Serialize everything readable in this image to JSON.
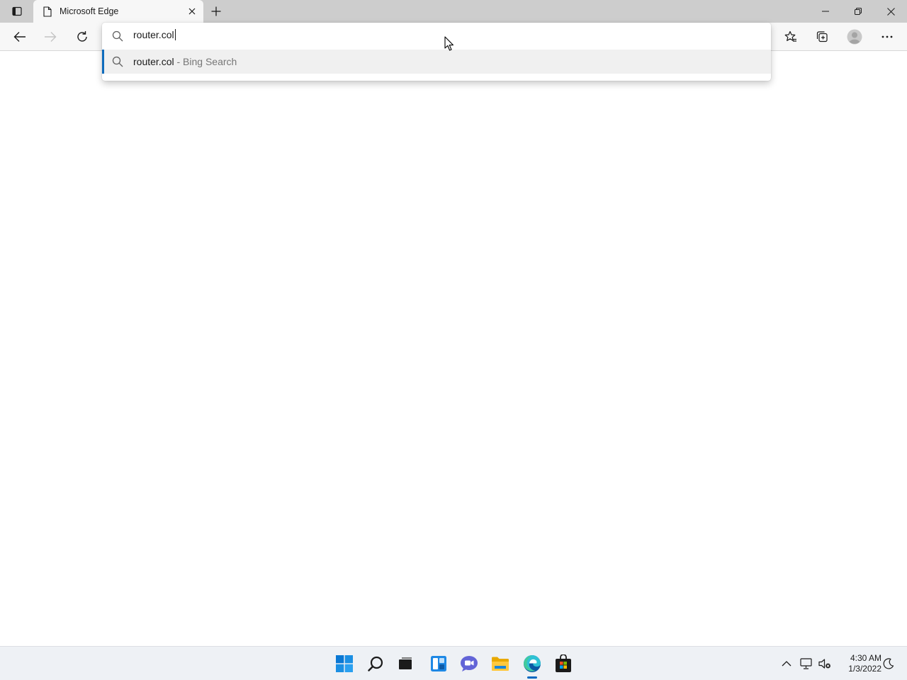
{
  "browser": {
    "tab": {
      "title": "Microsoft Edge"
    },
    "omnibox": {
      "query": "router.col",
      "suggestion": {
        "primary": "router.col",
        "secondary": " - Bing Search"
      }
    },
    "window_controls": [
      "minimize-icon",
      "restore-icon",
      "close-icon"
    ],
    "accent_color": "#0f6cbd"
  },
  "taskbar": {
    "apps": [
      "start-icon",
      "search-icon",
      "task-view-icon",
      "widgets-icon",
      "teams-chat-icon",
      "file-explorer-icon",
      "edge-icon",
      "store-icon"
    ],
    "active_app": "edge-icon",
    "clock": {
      "time": "4:30 AM",
      "date": "1/3/2022"
    }
  }
}
